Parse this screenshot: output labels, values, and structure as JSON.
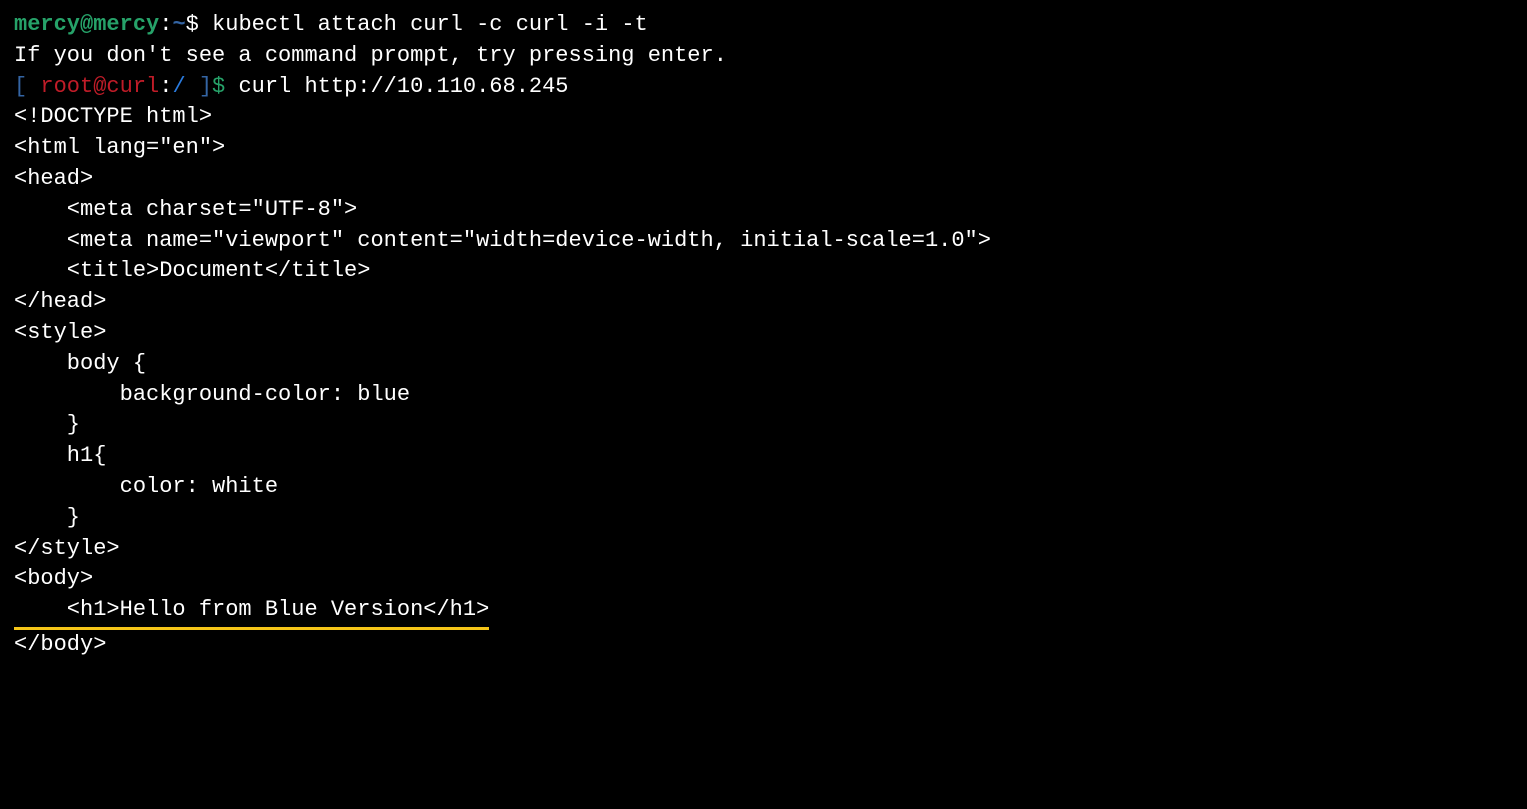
{
  "prompt1": {
    "userhost": "mercy@mercy",
    "colon": ":",
    "path": "~",
    "dollar": "$ ",
    "command": "kubectl attach curl -c curl -i -t"
  },
  "line2": "If you don't see a command prompt, try pressing enter.",
  "prompt2": {
    "open": "[ ",
    "userhost": "root@curl",
    "colon": ":",
    "path": "/ ",
    "close": "]",
    "dollar": "$ ",
    "command": "curl http://10.110.68.245"
  },
  "output": {
    "l1": "<!DOCTYPE html>",
    "l2": "<html lang=\"en\">",
    "l3": "<head>",
    "l4": "    <meta charset=\"UTF-8\">",
    "l5": "    <meta name=\"viewport\" content=\"width=device-width, initial-scale=1.0\">",
    "l6": "    <title>Document</title>",
    "l7": "</head>",
    "l8": "",
    "l9": "<style>",
    "l10": "    body {",
    "l11": "        background-color: blue",
    "l12": "    }",
    "l13": "    h1{",
    "l14": "        color: white",
    "l15": "    }",
    "l16": "</style>",
    "l17": "",
    "l18": "<body>",
    "l19": "    <h1>Hello from Blue Version</h1>",
    "l20": "</body>"
  }
}
